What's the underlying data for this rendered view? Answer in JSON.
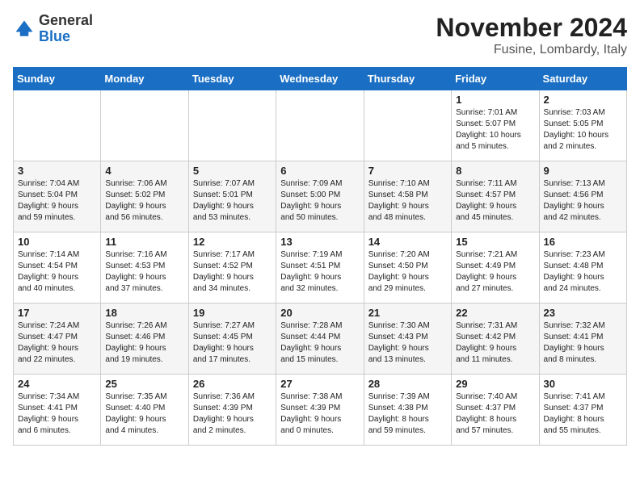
{
  "header": {
    "logo_general": "General",
    "logo_blue": "Blue",
    "month_title": "November 2024",
    "subtitle": "Fusine, Lombardy, Italy"
  },
  "weekdays": [
    "Sunday",
    "Monday",
    "Tuesday",
    "Wednesday",
    "Thursday",
    "Friday",
    "Saturday"
  ],
  "weeks": [
    [
      {
        "day": "",
        "info": ""
      },
      {
        "day": "",
        "info": ""
      },
      {
        "day": "",
        "info": ""
      },
      {
        "day": "",
        "info": ""
      },
      {
        "day": "",
        "info": ""
      },
      {
        "day": "1",
        "info": "Sunrise: 7:01 AM\nSunset: 5:07 PM\nDaylight: 10 hours\nand 5 minutes."
      },
      {
        "day": "2",
        "info": "Sunrise: 7:03 AM\nSunset: 5:05 PM\nDaylight: 10 hours\nand 2 minutes."
      }
    ],
    [
      {
        "day": "3",
        "info": "Sunrise: 7:04 AM\nSunset: 5:04 PM\nDaylight: 9 hours\nand 59 minutes."
      },
      {
        "day": "4",
        "info": "Sunrise: 7:06 AM\nSunset: 5:02 PM\nDaylight: 9 hours\nand 56 minutes."
      },
      {
        "day": "5",
        "info": "Sunrise: 7:07 AM\nSunset: 5:01 PM\nDaylight: 9 hours\nand 53 minutes."
      },
      {
        "day": "6",
        "info": "Sunrise: 7:09 AM\nSunset: 5:00 PM\nDaylight: 9 hours\nand 50 minutes."
      },
      {
        "day": "7",
        "info": "Sunrise: 7:10 AM\nSunset: 4:58 PM\nDaylight: 9 hours\nand 48 minutes."
      },
      {
        "day": "8",
        "info": "Sunrise: 7:11 AM\nSunset: 4:57 PM\nDaylight: 9 hours\nand 45 minutes."
      },
      {
        "day": "9",
        "info": "Sunrise: 7:13 AM\nSunset: 4:56 PM\nDaylight: 9 hours\nand 42 minutes."
      }
    ],
    [
      {
        "day": "10",
        "info": "Sunrise: 7:14 AM\nSunset: 4:54 PM\nDaylight: 9 hours\nand 40 minutes."
      },
      {
        "day": "11",
        "info": "Sunrise: 7:16 AM\nSunset: 4:53 PM\nDaylight: 9 hours\nand 37 minutes."
      },
      {
        "day": "12",
        "info": "Sunrise: 7:17 AM\nSunset: 4:52 PM\nDaylight: 9 hours\nand 34 minutes."
      },
      {
        "day": "13",
        "info": "Sunrise: 7:19 AM\nSunset: 4:51 PM\nDaylight: 9 hours\nand 32 minutes."
      },
      {
        "day": "14",
        "info": "Sunrise: 7:20 AM\nSunset: 4:50 PM\nDaylight: 9 hours\nand 29 minutes."
      },
      {
        "day": "15",
        "info": "Sunrise: 7:21 AM\nSunset: 4:49 PM\nDaylight: 9 hours\nand 27 minutes."
      },
      {
        "day": "16",
        "info": "Sunrise: 7:23 AM\nSunset: 4:48 PM\nDaylight: 9 hours\nand 24 minutes."
      }
    ],
    [
      {
        "day": "17",
        "info": "Sunrise: 7:24 AM\nSunset: 4:47 PM\nDaylight: 9 hours\nand 22 minutes."
      },
      {
        "day": "18",
        "info": "Sunrise: 7:26 AM\nSunset: 4:46 PM\nDaylight: 9 hours\nand 19 minutes."
      },
      {
        "day": "19",
        "info": "Sunrise: 7:27 AM\nSunset: 4:45 PM\nDaylight: 9 hours\nand 17 minutes."
      },
      {
        "day": "20",
        "info": "Sunrise: 7:28 AM\nSunset: 4:44 PM\nDaylight: 9 hours\nand 15 minutes."
      },
      {
        "day": "21",
        "info": "Sunrise: 7:30 AM\nSunset: 4:43 PM\nDaylight: 9 hours\nand 13 minutes."
      },
      {
        "day": "22",
        "info": "Sunrise: 7:31 AM\nSunset: 4:42 PM\nDaylight: 9 hours\nand 11 minutes."
      },
      {
        "day": "23",
        "info": "Sunrise: 7:32 AM\nSunset: 4:41 PM\nDaylight: 9 hours\nand 8 minutes."
      }
    ],
    [
      {
        "day": "24",
        "info": "Sunrise: 7:34 AM\nSunset: 4:41 PM\nDaylight: 9 hours\nand 6 minutes."
      },
      {
        "day": "25",
        "info": "Sunrise: 7:35 AM\nSunset: 4:40 PM\nDaylight: 9 hours\nand 4 minutes."
      },
      {
        "day": "26",
        "info": "Sunrise: 7:36 AM\nSunset: 4:39 PM\nDaylight: 9 hours\nand 2 minutes."
      },
      {
        "day": "27",
        "info": "Sunrise: 7:38 AM\nSunset: 4:39 PM\nDaylight: 9 hours\nand 0 minutes."
      },
      {
        "day": "28",
        "info": "Sunrise: 7:39 AM\nSunset: 4:38 PM\nDaylight: 8 hours\nand 59 minutes."
      },
      {
        "day": "29",
        "info": "Sunrise: 7:40 AM\nSunset: 4:37 PM\nDaylight: 8 hours\nand 57 minutes."
      },
      {
        "day": "30",
        "info": "Sunrise: 7:41 AM\nSunset: 4:37 PM\nDaylight: 8 hours\nand 55 minutes."
      }
    ]
  ]
}
